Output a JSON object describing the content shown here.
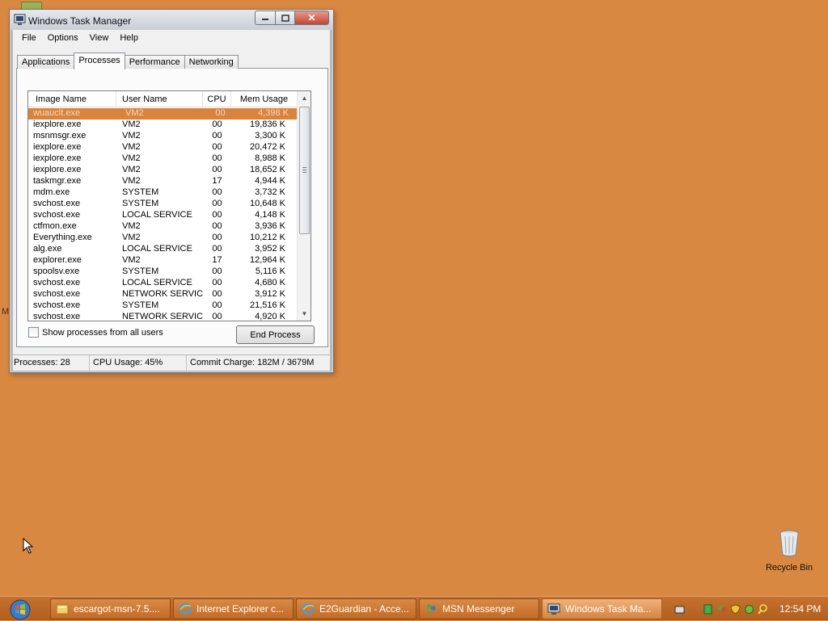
{
  "window": {
    "title": "Windows Task Manager",
    "menu": [
      "File",
      "Options",
      "View",
      "Help"
    ],
    "tabs": [
      "Applications",
      "Processes",
      "Performance",
      "Networking"
    ],
    "active_tab": "Processes",
    "columns": [
      "Image Name",
      "User Name",
      "CPU",
      "Mem Usage"
    ],
    "processes": [
      {
        "image": "wuauclt.exe",
        "user": "VM2",
        "cpu": "00",
        "mem": "4,398 K"
      },
      {
        "image": "iexplore.exe",
        "user": "VM2",
        "cpu": "00",
        "mem": "19,836 K"
      },
      {
        "image": "msnmsgr.exe",
        "user": "VM2",
        "cpu": "00",
        "mem": "3,300 K"
      },
      {
        "image": "iexplore.exe",
        "user": "VM2",
        "cpu": "00",
        "mem": "20,472 K"
      },
      {
        "image": "iexplore.exe",
        "user": "VM2",
        "cpu": "00",
        "mem": "8,988 K"
      },
      {
        "image": "iexplore.exe",
        "user": "VM2",
        "cpu": "00",
        "mem": "18,652 K"
      },
      {
        "image": "taskmgr.exe",
        "user": "VM2",
        "cpu": "17",
        "mem": "4,944 K"
      },
      {
        "image": "mdm.exe",
        "user": "SYSTEM",
        "cpu": "00",
        "mem": "3,732 K"
      },
      {
        "image": "svchost.exe",
        "user": "SYSTEM",
        "cpu": "00",
        "mem": "10,648 K"
      },
      {
        "image": "svchost.exe",
        "user": "LOCAL SERVICE",
        "cpu": "00",
        "mem": "4,148 K"
      },
      {
        "image": "ctfmon.exe",
        "user": "VM2",
        "cpu": "00",
        "mem": "3,936 K"
      },
      {
        "image": "Everything.exe",
        "user": "VM2",
        "cpu": "00",
        "mem": "10,212 K"
      },
      {
        "image": "alg.exe",
        "user": "LOCAL SERVICE",
        "cpu": "00",
        "mem": "3,952 K"
      },
      {
        "image": "explorer.exe",
        "user": "VM2",
        "cpu": "17",
        "mem": "12,964 K"
      },
      {
        "image": "spoolsv.exe",
        "user": "SYSTEM",
        "cpu": "00",
        "mem": "5,116 K"
      },
      {
        "image": "svchost.exe",
        "user": "LOCAL SERVICE",
        "cpu": "00",
        "mem": "4,680 K"
      },
      {
        "image": "svchost.exe",
        "user": "NETWORK SERVICE",
        "cpu": "00",
        "mem": "3,912 K"
      },
      {
        "image": "svchost.exe",
        "user": "SYSTEM",
        "cpu": "00",
        "mem": "21,516 K"
      },
      {
        "image": "svchost.exe",
        "user": "NETWORK SERVICE",
        "cpu": "00",
        "mem": "4,920 K"
      }
    ],
    "show_all_label": "Show processes from all users",
    "end_process_label": "End Process",
    "status": {
      "processes": "Processes: 28",
      "cpu": "CPU Usage: 45%",
      "commit": "Commit Charge: 182M / 3679M"
    }
  },
  "desktop": {
    "edge_text": "M",
    "recycle_bin_label": "Recycle Bin"
  },
  "taskbar": {
    "buttons": [
      {
        "label": "escargot-msn-7.5....",
        "icon": "folder-icon"
      },
      {
        "label": "Internet Explorer c...",
        "icon": "ie-icon"
      },
      {
        "label": "E2Guardian - Acce...",
        "icon": "ie-icon"
      },
      {
        "label": "MSN Messenger",
        "icon": "msn-icon"
      },
      {
        "label": "Windows Task Ma...",
        "icon": "taskmgr-icon"
      }
    ],
    "clock": "12:54 PM"
  },
  "colors": {
    "desktop": "#D98841",
    "selection": "#d9843e",
    "taskbar": "#c36b26"
  }
}
